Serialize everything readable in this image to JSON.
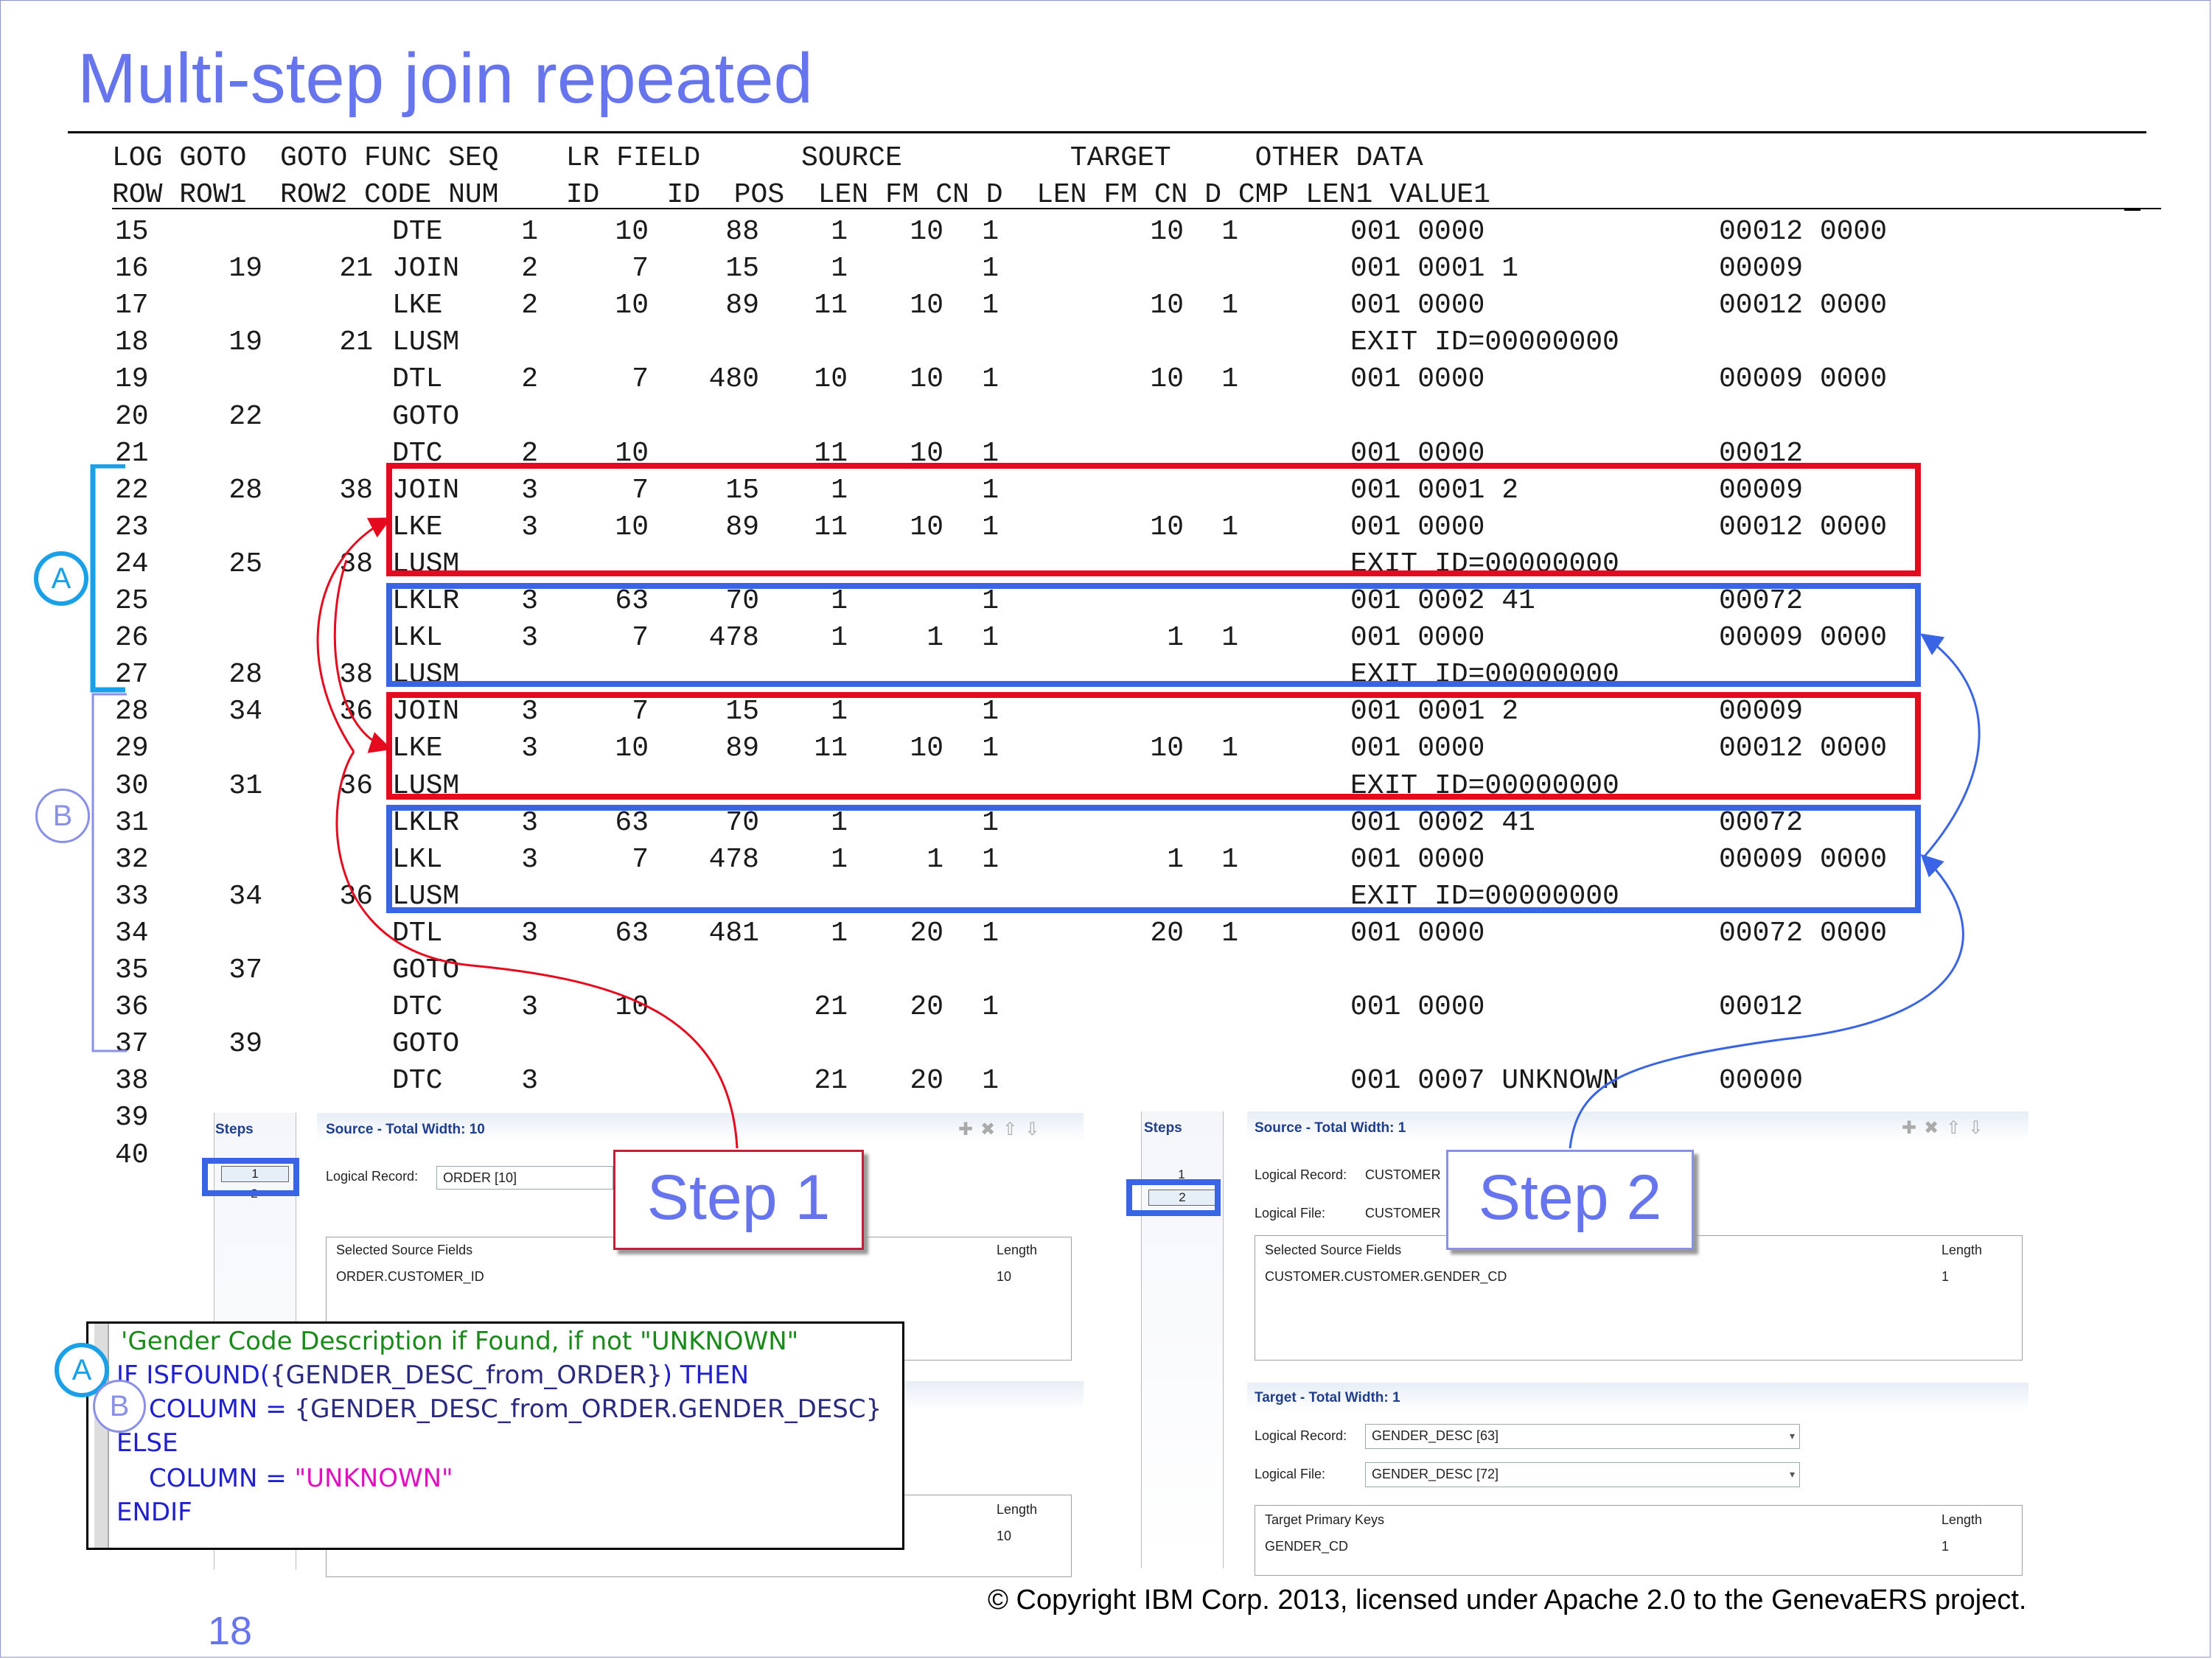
{
  "slide": {
    "title": "Multi-step join repeated",
    "page_number": "18",
    "copyright": "© Copyright IBM Corp. 2013, licensed under Apache 2.0 to the GenevaERS project."
  },
  "table": {
    "header1": "LOG GOTO  GOTO FUNC SEQ    LR FIELD      SOURCE          TARGET     OTHER DATA",
    "header2": "ROW ROW1  ROW2 CODE NUM    ID    ID  POS  LEN FM CN D  LEN FM CN D CMP LEN1 VALUE1",
    "rows": [
      {
        "log": "15",
        "g1": "",
        "g2": "",
        "fc": "DTE",
        "seq": "1",
        "lr": "10",
        "fld": "88",
        "pos": "1",
        "slen": "10",
        "sfm": "1",
        "tlen": "10",
        "tfm": "1",
        "other": "001 0000",
        "val": "00012 0000"
      },
      {
        "log": "16",
        "g1": "19",
        "g2": "21",
        "fc": "JOIN",
        "seq": "2",
        "lr": "7",
        "fld": "15",
        "pos": "1",
        "slen": "",
        "sfm": "1",
        "tlen": "",
        "tfm": "",
        "other": "001 0001 1",
        "val": "00009"
      },
      {
        "log": "17",
        "g1": "",
        "g2": "",
        "fc": "LKE",
        "seq": "2",
        "lr": "10",
        "fld": "89",
        "pos": "11",
        "slen": "10",
        "sfm": "1",
        "tlen": "10",
        "tfm": "1",
        "other": "001 0000",
        "val": "00012 0000"
      },
      {
        "log": "18",
        "g1": "19",
        "g2": "21",
        "fc": "LUSM",
        "seq": "",
        "lr": "",
        "fld": "",
        "pos": "",
        "slen": "",
        "sfm": "",
        "tlen": "",
        "tfm": "",
        "other": "EXIT ID=00000000",
        "val": ""
      },
      {
        "log": "19",
        "g1": "",
        "g2": "",
        "fc": "DTL",
        "seq": "2",
        "lr": "7",
        "fld": "480",
        "pos": "10",
        "slen": "10",
        "sfm": "1",
        "tlen": "10",
        "tfm": "1",
        "other": "001 0000",
        "val": "00009 0000"
      },
      {
        "log": "20",
        "g1": "22",
        "g2": "",
        "fc": "GOTO",
        "seq": "",
        "lr": "",
        "fld": "",
        "pos": "",
        "slen": "",
        "sfm": "",
        "tlen": "",
        "tfm": "",
        "other": "",
        "val": ""
      },
      {
        "log": "21",
        "g1": "",
        "g2": "",
        "fc": "DTC",
        "seq": "2",
        "lr": "10",
        "fld": "",
        "pos": "11",
        "slen": "10",
        "sfm": "1",
        "tlen": "",
        "tfm": "",
        "other": "001 0000",
        "val": "00012"
      },
      {
        "log": "22",
        "g1": "28",
        "g2": "38",
        "fc": "JOIN",
        "seq": "3",
        "lr": "7",
        "fld": "15",
        "pos": "1",
        "slen": "",
        "sfm": "1",
        "tlen": "",
        "tfm": "",
        "other": "001 0001 2",
        "val": "00009"
      },
      {
        "log": "23",
        "g1": "",
        "g2": "",
        "fc": "LKE",
        "seq": "3",
        "lr": "10",
        "fld": "89",
        "pos": "11",
        "slen": "10",
        "sfm": "1",
        "tlen": "10",
        "tfm": "1",
        "other": "001 0000",
        "val": "00012 0000"
      },
      {
        "log": "24",
        "g1": "25",
        "g2": "38",
        "fc": "LUSM",
        "seq": "",
        "lr": "",
        "fld": "",
        "pos": "",
        "slen": "",
        "sfm": "",
        "tlen": "",
        "tfm": "",
        "other": "EXIT ID=00000000",
        "val": ""
      },
      {
        "log": "25",
        "g1": "",
        "g2": "",
        "fc": "LKLR",
        "seq": "3",
        "lr": "63",
        "fld": "70",
        "pos": "1",
        "slen": "",
        "sfm": "1",
        "tlen": "",
        "tfm": "",
        "other": "001 0002 41",
        "val": "00072"
      },
      {
        "log": "26",
        "g1": "",
        "g2": "",
        "fc": "LKL",
        "seq": "3",
        "lr": "7",
        "fld": "478",
        "pos": "1",
        "slen": "1",
        "sfm": "1",
        "tlen": "1",
        "tfm": "1",
        "other": "001 0000",
        "val": "00009 0000"
      },
      {
        "log": "27",
        "g1": "28",
        "g2": "38",
        "fc": "LUSM",
        "seq": "",
        "lr": "",
        "fld": "",
        "pos": "",
        "slen": "",
        "sfm": "",
        "tlen": "",
        "tfm": "",
        "other": "EXIT ID=00000000",
        "val": ""
      },
      {
        "log": "28",
        "g1": "34",
        "g2": "36",
        "fc": "JOIN",
        "seq": "3",
        "lr": "7",
        "fld": "15",
        "pos": "1",
        "slen": "",
        "sfm": "1",
        "tlen": "",
        "tfm": "",
        "other": "001 0001 2",
        "val": "00009"
      },
      {
        "log": "29",
        "g1": "",
        "g2": "",
        "fc": "LKE",
        "seq": "3",
        "lr": "10",
        "fld": "89",
        "pos": "11",
        "slen": "10",
        "sfm": "1",
        "tlen": "10",
        "tfm": "1",
        "other": "001 0000",
        "val": "00012 0000"
      },
      {
        "log": "30",
        "g1": "31",
        "g2": "36",
        "fc": "LUSM",
        "seq": "",
        "lr": "",
        "fld": "",
        "pos": "",
        "slen": "",
        "sfm": "",
        "tlen": "",
        "tfm": "",
        "other": "EXIT ID=00000000",
        "val": ""
      },
      {
        "log": "31",
        "g1": "",
        "g2": "",
        "fc": "LKLR",
        "seq": "3",
        "lr": "63",
        "fld": "70",
        "pos": "1",
        "slen": "",
        "sfm": "1",
        "tlen": "",
        "tfm": "",
        "other": "001 0002 41",
        "val": "00072"
      },
      {
        "log": "32",
        "g1": "",
        "g2": "",
        "fc": "LKL",
        "seq": "3",
        "lr": "7",
        "fld": "478",
        "pos": "1",
        "slen": "1",
        "sfm": "1",
        "tlen": "1",
        "tfm": "1",
        "other": "001 0000",
        "val": "00009 0000"
      },
      {
        "log": "33",
        "g1": "34",
        "g2": "36",
        "fc": "LUSM",
        "seq": "",
        "lr": "",
        "fld": "",
        "pos": "",
        "slen": "",
        "sfm": "",
        "tlen": "",
        "tfm": "",
        "other": "EXIT ID=00000000",
        "val": ""
      },
      {
        "log": "34",
        "g1": "",
        "g2": "",
        "fc": "DTL",
        "seq": "3",
        "lr": "63",
        "fld": "481",
        "pos": "1",
        "slen": "20",
        "sfm": "1",
        "tlen": "20",
        "tfm": "1",
        "other": "001 0000",
        "val": "00072 0000"
      },
      {
        "log": "35",
        "g1": "37",
        "g2": "",
        "fc": "GOTO",
        "seq": "",
        "lr": "",
        "fld": "",
        "pos": "",
        "slen": "",
        "sfm": "",
        "tlen": "",
        "tfm": "",
        "other": "",
        "val": ""
      },
      {
        "log": "36",
        "g1": "",
        "g2": "",
        "fc": "DTC",
        "seq": "3",
        "lr": "10",
        "fld": "",
        "pos": "21",
        "slen": "20",
        "sfm": "1",
        "tlen": "",
        "tfm": "",
        "other": "001 0000",
        "val": "00012"
      },
      {
        "log": "37",
        "g1": "39",
        "g2": "",
        "fc": "GOTO",
        "seq": "",
        "lr": "",
        "fld": "",
        "pos": "",
        "slen": "",
        "sfm": "",
        "tlen": "",
        "tfm": "",
        "other": "",
        "val": ""
      },
      {
        "log": "38",
        "g1": "",
        "g2": "",
        "fc": "DTC",
        "seq": "3",
        "lr": "",
        "fld": "",
        "pos": "21",
        "slen": "20",
        "sfm": "1",
        "tlen": "",
        "tfm": "",
        "other": "001 0007 UNKNOWN",
        "val": "00000"
      },
      {
        "log": "39",
        "g1": "",
        "g2": "",
        "fc": "",
        "seq": "",
        "lr": "",
        "fld": "",
        "pos": "",
        "slen": "",
        "sfm": "",
        "tlen": "",
        "tfm": "",
        "other": "",
        "val": ""
      },
      {
        "log": "40",
        "g1": "",
        "g2": "",
        "fc": "",
        "seq": "",
        "lr": "",
        "fld": "",
        "pos": "",
        "slen": "",
        "sfm": "",
        "tlen": "",
        "tfm": "",
        "other": "",
        "val": ""
      }
    ]
  },
  "markers": {
    "a": "A",
    "b": "B"
  },
  "step1_panel": {
    "steps_label": "Steps",
    "step_items": [
      "1",
      "2"
    ],
    "source_title": "Source - Total Width: 10",
    "logical_record_label": "Logical Record:",
    "logical_record_value": "ORDER [10]",
    "fields_header": "Selected Source Fields",
    "length_header": "Length",
    "field_value": "ORDER.CUSTOMER_ID",
    "field_length": "10",
    "bottom_length_header": "Length",
    "bottom_length_value": "10"
  },
  "step2_panel": {
    "steps_label": "Steps",
    "step_items": [
      "1",
      "2"
    ],
    "source_title": "Source - Total Width: 1",
    "logical_record_label": "Logical Record:",
    "logical_record_value": "CUSTOMER",
    "logical_file_label": "Logical File:",
    "logical_file_value": "CUSTOMER",
    "fields_header": "Selected Source Fields",
    "length_header": "Length",
    "field_value": "CUSTOMER.CUSTOMER.GENDER_CD",
    "field_length": "1",
    "target_title": "Target - Total Width: 1",
    "target_lr_label": "Logical Record:",
    "target_lr_value": "GENDER_DESC [63]",
    "target_lf_label": "Logical File:",
    "target_lf_value": "GENDER_DESC [72]",
    "keys_header": "Target Primary Keys",
    "keys_length_header": "Length",
    "key_value": "GENDER_CD",
    "key_length": "1"
  },
  "callouts": {
    "step1": "Step 1",
    "step2": "Step 2"
  },
  "code": {
    "line1": "'Gender Code Description if Found, if not \"UNKNOWN\"",
    "line2_kw": "IF ISFOUND(",
    "line2_ref": "{GENDER_DESC_from_ORDER}",
    "line2_then": ") THEN",
    "line3_col": "COLUMN = ",
    "line3_ref": "{GENDER_DESC_from_ORDER.GENDER_DESC}",
    "line4": "ELSE",
    "line5_col": "COLUMN = ",
    "line5_str": "\"UNKNOWN\"",
    "line6": "ENDIF"
  },
  "colors": {
    "title": "#6674ee",
    "red_box": "#e60a1e",
    "blue_box": "#3a64e6",
    "code_comment": "#1a8a1a",
    "code_keyword": "#2020d0",
    "code_string": "#e010c0"
  }
}
